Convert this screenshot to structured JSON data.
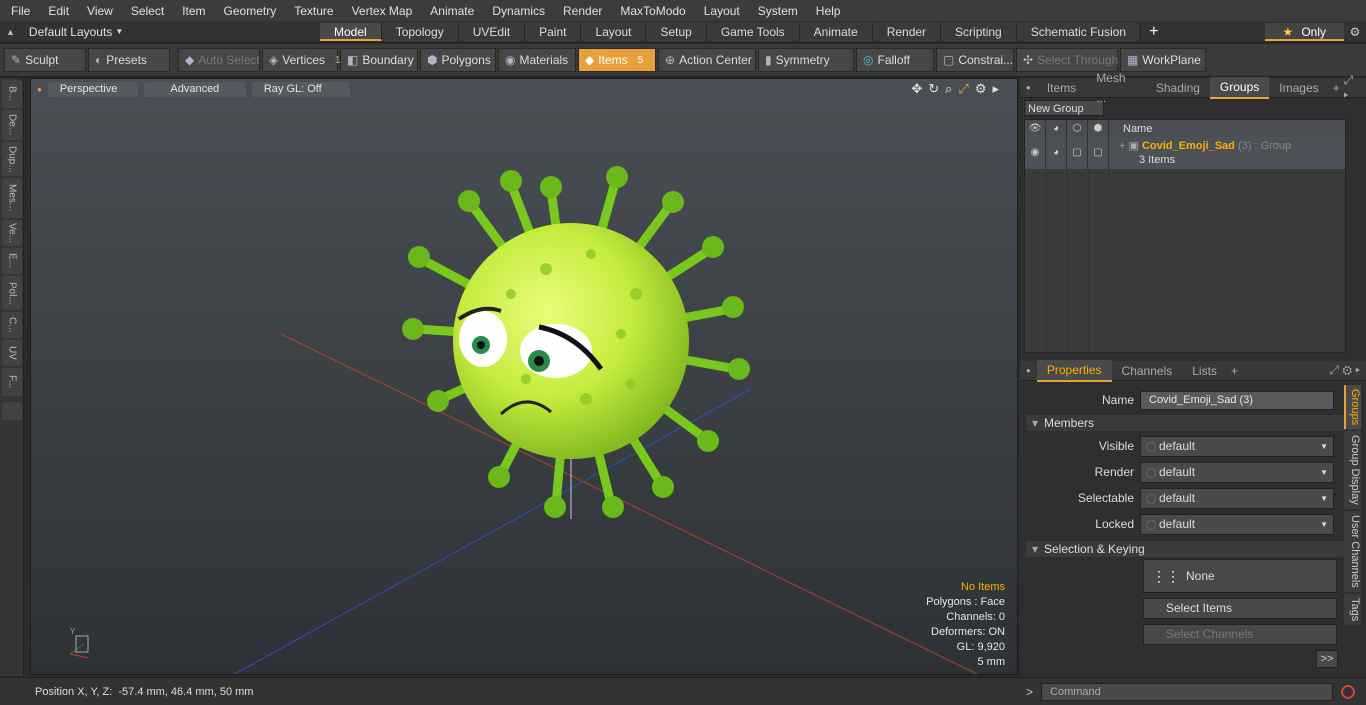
{
  "menu": [
    "File",
    "Edit",
    "View",
    "Select",
    "Item",
    "Geometry",
    "Texture",
    "Vertex Map",
    "Animate",
    "Dynamics",
    "Render",
    "MaxToModo",
    "Layout",
    "System",
    "Help"
  ],
  "layout_dropdown": "Default Layouts",
  "layout_tabs": [
    "Model",
    "Topology",
    "UVEdit",
    "Paint",
    "Layout",
    "Setup",
    "Game Tools",
    "Animate",
    "Render",
    "Scripting",
    "Schematic Fusion"
  ],
  "only_label": "Only",
  "toolbar": {
    "sculpt": "Sculpt",
    "presets": "Presets",
    "auto_select": "Auto Select",
    "vertices": "Vertices",
    "vertices_count": "1",
    "boundary": "Boundary",
    "polygons": "Polygons",
    "materials": "Materials",
    "items": "Items",
    "items_count": "5",
    "action_center": "Action Center",
    "symmetry": "Symmetry",
    "falloff": "Falloff",
    "constraints": "Constrai...",
    "select_through": "Select Through",
    "workplane": "WorkPlane"
  },
  "left_tabs": [
    "B...",
    "De...",
    "Dup...",
    "Mes...",
    "Ve...",
    "E...",
    "Pol...",
    "C...",
    "UV",
    "F..."
  ],
  "viewport": {
    "view": "Perspective",
    "mode": "Advanced",
    "raygl": "Ray GL: Off",
    "stats": {
      "items": "No Items",
      "polygons": "Polygons : Face",
      "channels": "Channels: 0",
      "deformers": "Deformers: ON",
      "gl": "GL: 9,920",
      "scale": "5 mm"
    }
  },
  "status": "Position X, Y, Z:  -57.4 mm, 46.4 mm, 50 mm",
  "top_panel": {
    "tabs": [
      "Items",
      "Mesh ...",
      "Shading",
      "Groups",
      "Images"
    ],
    "new_group": "New Group",
    "name_header": "Name",
    "group": {
      "name": "Covid_Emoji_Sad",
      "count": "(3)",
      "type": ": Group",
      "items": "3 Items"
    }
  },
  "props_panel": {
    "tabs": [
      "Properties",
      "Channels",
      "Lists"
    ],
    "name_label": "Name",
    "name_value": "Covid_Emoji_Sad (3)",
    "members": "Members",
    "fields": [
      {
        "label": "Visible",
        "value": "default"
      },
      {
        "label": "Render",
        "value": "default"
      },
      {
        "label": "Selectable",
        "value": "default"
      },
      {
        "label": "Locked",
        "value": "default"
      }
    ],
    "selection_keying": "Selection & Keying",
    "none": "None",
    "select_items": "Select Items",
    "select_channels": "Select Channels",
    "more": ">>",
    "side_tabs": [
      "Groups",
      "Group Display",
      "User Channels",
      "Tags"
    ]
  },
  "command_placeholder": "Command"
}
